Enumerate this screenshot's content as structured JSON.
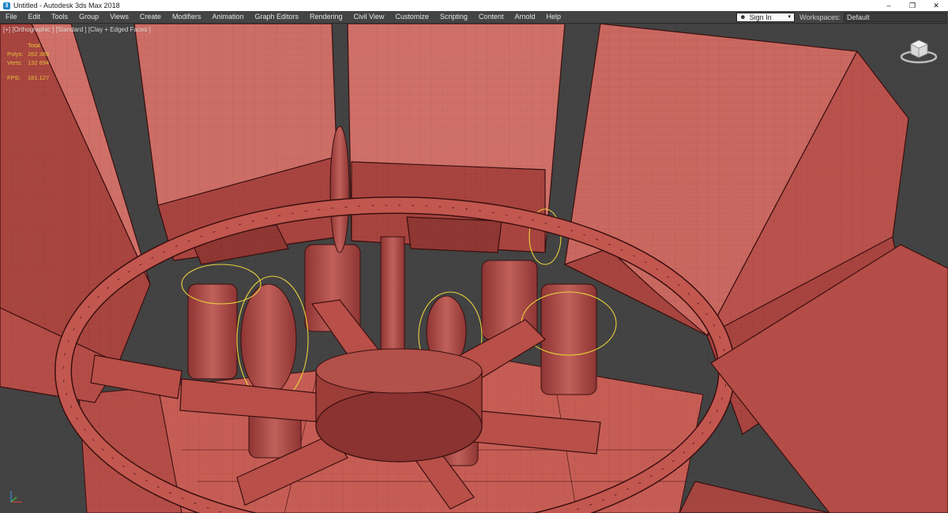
{
  "window": {
    "title": "Untitled - Autodesk 3ds Max 2018",
    "app_icon": "3ds-max-icon"
  },
  "menu": {
    "items": [
      "File",
      "Edit",
      "Tools",
      "Group",
      "Views",
      "Create",
      "Modifiers",
      "Animation",
      "Graph Editors",
      "Rendering",
      "Civil View",
      "Customize",
      "Scripting",
      "Content",
      "Arnold",
      "Help"
    ],
    "sign_in": "Sign In",
    "workspaces_label": "Workspaces:",
    "workspace_value": "Default"
  },
  "viewport": {
    "label": "[+] [Orthographic ] [Standard ] [Clay + Edged Faces ]",
    "stats": {
      "total_label": "Total",
      "polys_label": "Polys:",
      "polys_value": "262 388",
      "verts_label": "Verts:",
      "verts_value": "132 694",
      "fps_label": "FPS:",
      "fps_value": "181.127"
    },
    "colors": {
      "background": "#434343",
      "clay": "#b9514c",
      "clay_light": "#d37a72",
      "clay_dark": "#7a2c2a",
      "wire": "#3a0f0e",
      "light_gizmo": "#e8d23c"
    }
  }
}
